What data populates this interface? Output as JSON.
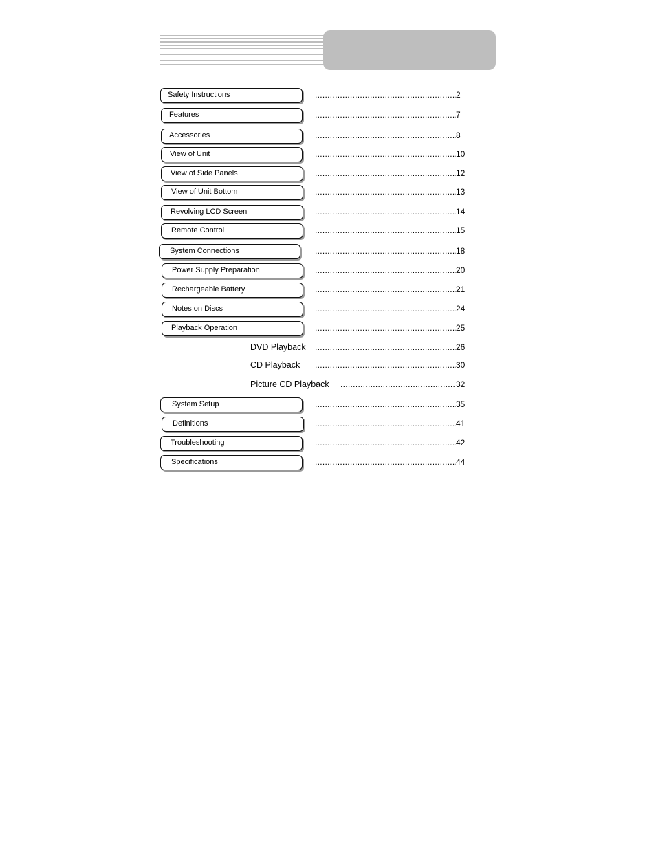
{
  "toc": {
    "sections": [
      {
        "label": "Safety Instructions",
        "page": "2"
      },
      {
        "label": "Features",
        "page": "7"
      },
      {
        "label": "Accessories",
        "page": "8"
      },
      {
        "label": "View of Unit",
        "page": "10"
      },
      {
        "label": "View of Side Panels",
        "page": "12"
      },
      {
        "label": "View of Unit Bottom",
        "page": "13"
      },
      {
        "label": "Revolving LCD Screen",
        "page": "14"
      },
      {
        "label": "Remote Control",
        "page": "15"
      },
      {
        "label": "System Connections",
        "page": "18"
      },
      {
        "label": "Power Supply Preparation",
        "page": "20"
      },
      {
        "label": "Rechargeable Battery",
        "page": "21"
      },
      {
        "label": "Notes on Discs",
        "page": "24"
      },
      {
        "label": "Playback Operation",
        "page": "25"
      }
    ],
    "subsections": [
      {
        "label": "DVD Playback",
        "page": "26"
      },
      {
        "label": "CD Playback",
        "page": "30"
      },
      {
        "label": "Picture CD Playback",
        "page": "32"
      }
    ],
    "sections_after": [
      {
        "label": "System Setup",
        "page": "35"
      },
      {
        "label": "Definitions",
        "page": "41"
      },
      {
        "label": "Troubleshooting",
        "page": "42"
      },
      {
        "label": "Specifications",
        "page": "44"
      }
    ],
    "leader": "……………………………………………"
  }
}
